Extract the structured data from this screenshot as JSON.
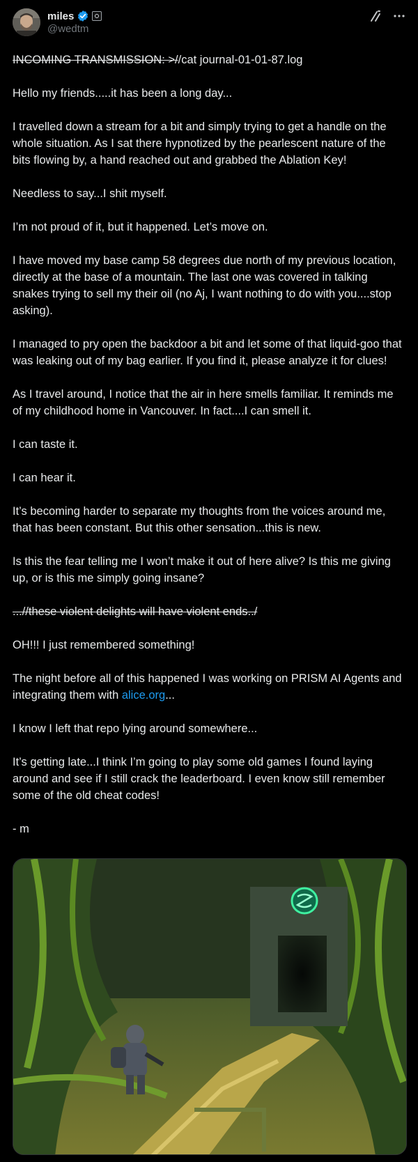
{
  "author": {
    "display_name": "miles",
    "handle": "@wedtm",
    "avatar_icon": "avatar-photo",
    "verified_icon": "verified-badge-icon",
    "affiliation_icon": "affiliation-badge-icon"
  },
  "header_actions": {
    "grok_icon": "∕╱",
    "more_icon": "···"
  },
  "post": {
    "prefix_strike": "INCOMING TRANSMISSION: >/",
    "command": "/cat journal-01-01-87.log",
    "p1": "Hello my friends.....it has been a long day...",
    "p2": "I travelled down a stream for a bit and simply trying to get a handle on the whole situation. As I sat there hypnotized by the pearlescent nature of the bits flowing by, a hand reached out and grabbed the Ablation Key!",
    "p3": "Needless to say...I shit myself.",
    "p4": "I’m not proud of it, but it happened. Let’s move on.",
    "p5": "I have moved my base camp 58 degrees due north of my previous location, directly at the base of a mountain. The last one was covered in talking snakes trying to sell my their oil (no Aj, I want nothing to do with you....stop asking).",
    "p6": "I managed to pry open the backdoor a bit and let some of that liquid-goo that was leaking out of my bag earlier. If you find it, please analyze it for clues!",
    "p7": "As I travel around, I notice that the air in here smells familiar. It reminds me of my childhood home in Vancouver. In fact....I can smell it.",
    "p8": "I can taste it.",
    "p9": "I can hear it.",
    "p10": "It’s becoming harder to separate my thoughts from the voices around me, that has been constant. But this other sensation...this is new.",
    "p11": "Is this the fear telling me I won’t make it out of here alive? Is this me giving up, or is this me simply going insane?",
    "p12_strike": "...//these violent delights will have violent ends../",
    "p13": "OH!!! I just remembered something!",
    "p14_before": "The night before all of this happened I was working on PRISM AI Agents and integrating them with ",
    "p14_link": "alice.org",
    "p14_after": "...",
    "p15": "I know I left that repo lying around somewhere...",
    "p16": "It’s getting late...I think I’m going to play some old games I found laying around and see if I still crack the leaderboard. I even know still remember some of the old cheat codes!",
    "signoff": "- m"
  },
  "media": {
    "description_icon": "jungle-temple-illustration"
  },
  "colors": {
    "background": "#000000",
    "text": "#e7e9ea",
    "muted": "#71767b",
    "link": "#1d9bf0",
    "verified": "#1d9bf0"
  }
}
